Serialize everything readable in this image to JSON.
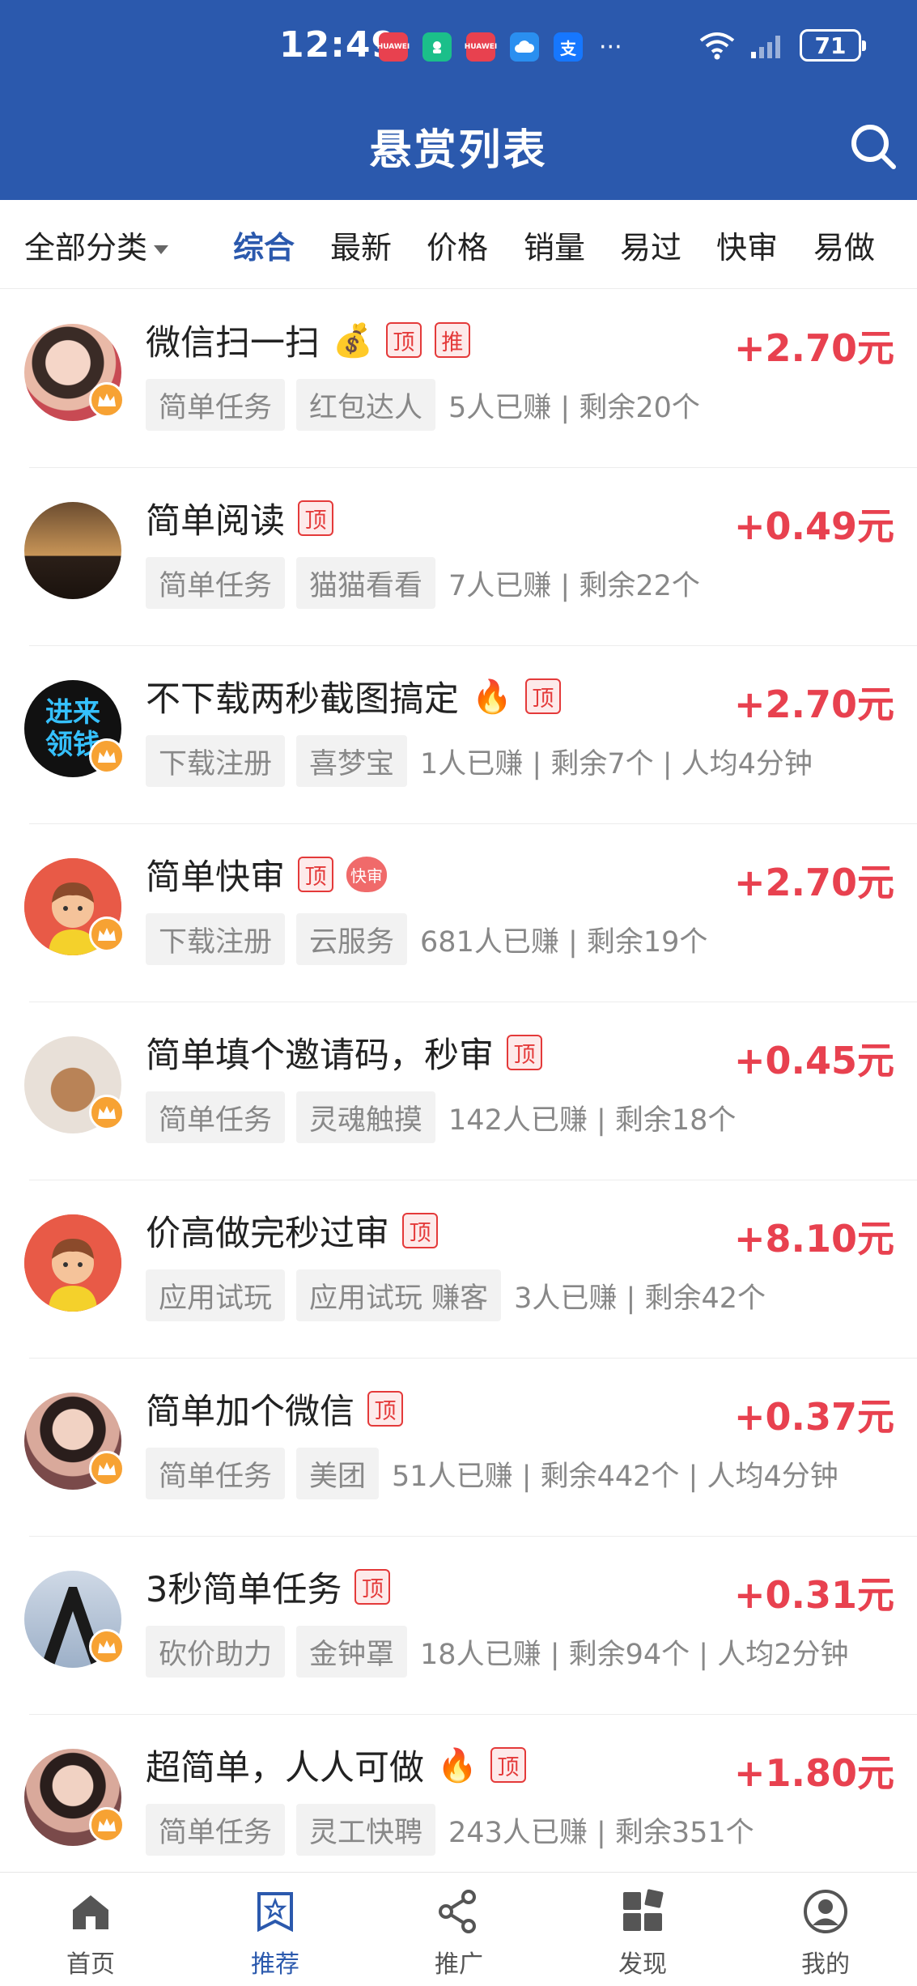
{
  "status_bar": {
    "time": "12:49",
    "notifications": [
      "HUAWEI",
      "app",
      "HUAWEI",
      "cloud",
      "支"
    ],
    "more": "···",
    "battery": "71"
  },
  "header": {
    "title": "悬赏列表"
  },
  "filters": {
    "category": "全部分类",
    "tabs": [
      "综合",
      "最新",
      "价格",
      "销量",
      "易过",
      "快审",
      "易做"
    ],
    "active_tab": "综合"
  },
  "tasks": [
    {
      "title": "微信扫一扫",
      "emoji": "💰",
      "badges": [
        "顶",
        "推"
      ],
      "reward": "+2.70元",
      "tags": [
        "简单任务",
        "红包达人"
      ],
      "stats": "5人已赚 | 剩余20个"
    },
    {
      "title": "简单阅读",
      "emoji": "",
      "badges": [
        "顶"
      ],
      "reward": "+0.49元",
      "tags": [
        "简单任务",
        "猫猫看看"
      ],
      "stats": "7人已赚 | 剩余22个"
    },
    {
      "title": "不下载两秒截图搞定",
      "emoji": "🔥",
      "badges": [
        "顶"
      ],
      "reward": "+2.70元",
      "tags": [
        "下载注册",
        "喜梦宝"
      ],
      "stats": "1人已赚 | 剩余7个 | 人均4分钟",
      "avatar_text": "进来领钱"
    },
    {
      "title": "简单快审",
      "emoji": "",
      "badges": [
        "顶"
      ],
      "fast_badge": "快审",
      "reward": "+2.70元",
      "tags": [
        "下载注册",
        "云服务"
      ],
      "stats": "681人已赚 | 剩余19个"
    },
    {
      "title": "简单填个邀请码，秒审",
      "emoji": "",
      "badges": [
        "顶"
      ],
      "reward": "+0.45元",
      "tags": [
        "简单任务",
        "灵魂触摸"
      ],
      "stats": "142人已赚 | 剩余18个"
    },
    {
      "title": "价高做完秒过审",
      "emoji": "",
      "badges": [
        "顶"
      ],
      "reward": "+8.10元",
      "tags": [
        "应用试玩",
        "应用试玩 赚客"
      ],
      "stats": "3人已赚 | 剩余42个"
    },
    {
      "title": "简单加个微信",
      "emoji": "",
      "badges": [
        "顶"
      ],
      "reward": "+0.37元",
      "tags": [
        "简单任务",
        "美团"
      ],
      "stats": "51人已赚 | 剩余442个 | 人均4分钟"
    },
    {
      "title": "3秒简单任务",
      "emoji": "",
      "badges": [
        "顶"
      ],
      "reward": "+0.31元",
      "tags": [
        "砍价助力",
        "金钟罩"
      ],
      "stats": "18人已赚 | 剩余94个 | 人均2分钟"
    },
    {
      "title": "超简单，人人可做",
      "emoji": "🔥",
      "badges": [
        "顶"
      ],
      "reward": "+1.80元",
      "tags": [
        "简单任务",
        "灵工快聘"
      ],
      "stats": "243人已赚 | 剩余351个"
    }
  ],
  "bottom_nav": [
    {
      "label": "首页",
      "icon": "home-icon"
    },
    {
      "label": "推荐",
      "icon": "recommend-icon",
      "active": true
    },
    {
      "label": "推广",
      "icon": "share-icon"
    },
    {
      "label": "发现",
      "icon": "discover-icon"
    },
    {
      "label": "我的",
      "icon": "profile-icon"
    }
  ],
  "colors": {
    "header_bg": "#2b59ad",
    "reward": "#e8414f",
    "active": "#2b59ad"
  }
}
